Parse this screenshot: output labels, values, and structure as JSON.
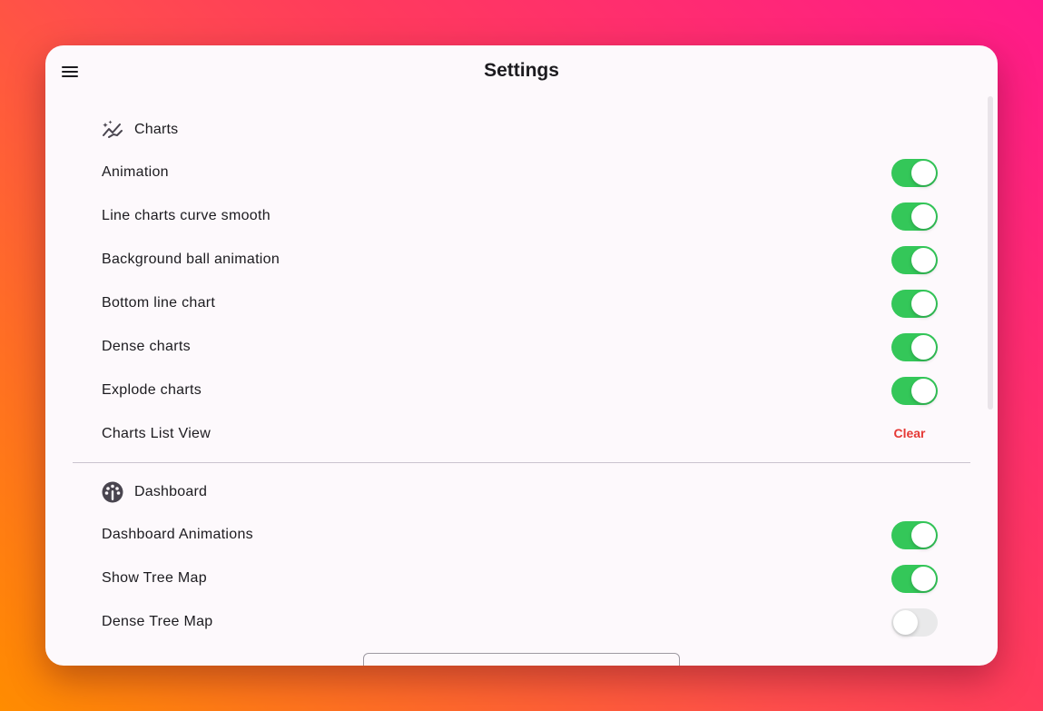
{
  "app": {
    "title": "Settings"
  },
  "icons": {
    "menu": "menu-icon",
    "charts": "auto-graph-icon",
    "dashboard": "speedometer-icon"
  },
  "colors": {
    "switch_on": "#34c759",
    "switch_off": "#e9e9ea",
    "clear": "#e53935"
  },
  "charts_section": {
    "title": "Charts",
    "settings": [
      {
        "label": "Animation",
        "enabled": true
      },
      {
        "label": "Line charts curve smooth",
        "enabled": true
      },
      {
        "label": "Background ball animation",
        "enabled": true
      },
      {
        "label": "Bottom line chart",
        "enabled": true
      },
      {
        "label": "Dense charts",
        "enabled": true
      },
      {
        "label": "Explode charts",
        "enabled": true
      }
    ],
    "list_view": {
      "label": "Charts List View",
      "action": "Clear"
    }
  },
  "dashboard_section": {
    "title": "Dashboard",
    "settings": [
      {
        "label": "Dashboard Animations",
        "enabled": true
      },
      {
        "label": "Show Tree Map",
        "enabled": true
      },
      {
        "label": "Dense Tree Map",
        "enabled": false
      }
    ]
  }
}
